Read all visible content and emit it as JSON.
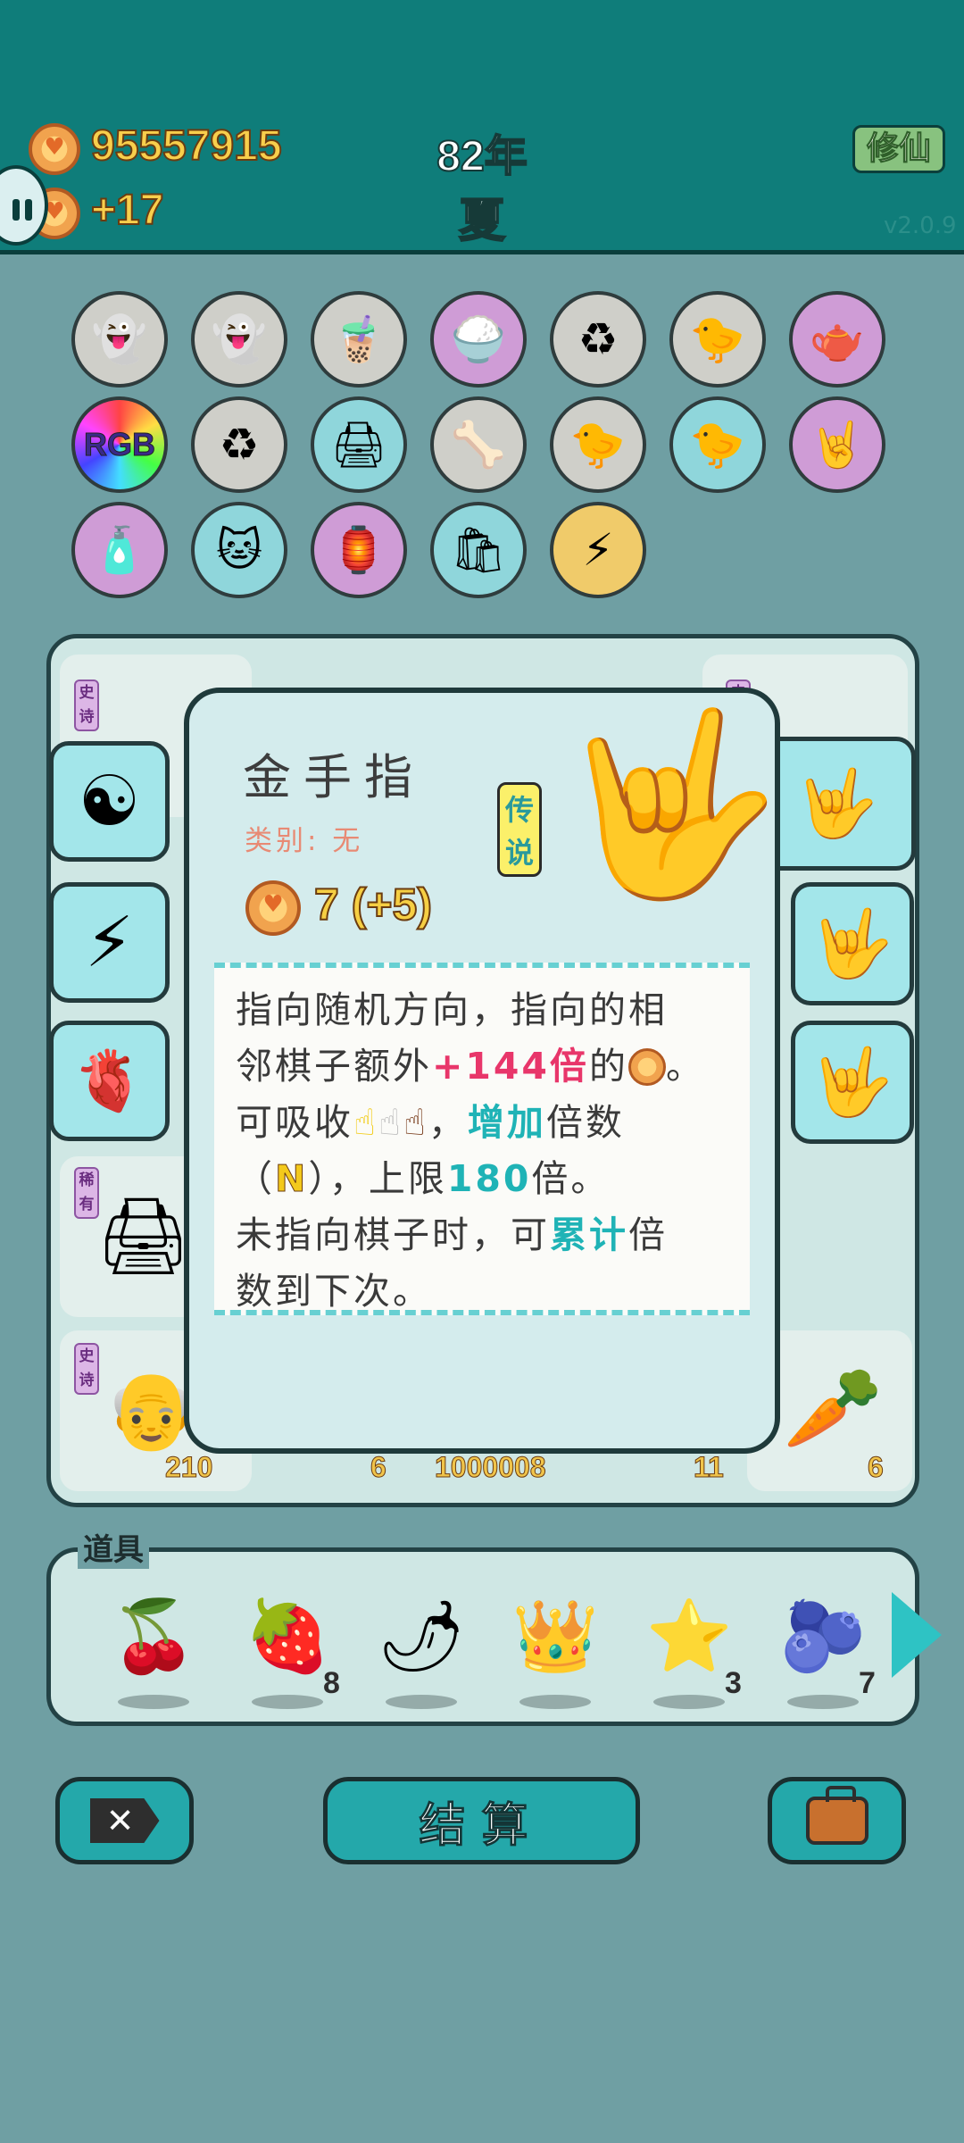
{
  "header": {
    "money": "95557915",
    "income": "+17",
    "year": "82年",
    "season": "夏",
    "mode_button": "修仙",
    "version": "v2.0.9"
  },
  "items": [
    {
      "name": "ghost-icon",
      "glyph": "👻",
      "style": "gray"
    },
    {
      "name": "ghost-icon",
      "glyph": "👻",
      "style": "gray"
    },
    {
      "name": "bubble-tea-icon",
      "glyph": "🧋",
      "style": "gray"
    },
    {
      "name": "rice-bowl-icon",
      "glyph": "🍚",
      "style": "purple"
    },
    {
      "name": "recycle-icon",
      "glyph": "♻",
      "style": "gray"
    },
    {
      "name": "chick-egg-icon",
      "glyph": "🐤",
      "style": "gray"
    },
    {
      "name": "gravy-boat-icon",
      "glyph": "🫖",
      "style": "purple"
    },
    {
      "name": "rgb-icon",
      "glyph": "RGB",
      "style": "rgb"
    },
    {
      "name": "recycle-icon",
      "glyph": "♻",
      "style": "gray"
    },
    {
      "name": "printer-icon",
      "glyph": "🖨",
      "style": "teal"
    },
    {
      "name": "pet-food-icon",
      "glyph": "🦴",
      "style": "gray"
    },
    {
      "name": "chick-egg-icon",
      "glyph": "🐤",
      "style": "gray"
    },
    {
      "name": "chick-egg-icon",
      "glyph": "🐤",
      "style": "teal"
    },
    {
      "name": "rock-hand-icon",
      "glyph": "🤘",
      "style": "purple"
    },
    {
      "name": "spray-bottle-icon",
      "glyph": "🧴",
      "style": "purple"
    },
    {
      "name": "cat-icon",
      "glyph": "🐱",
      "style": "teal"
    },
    {
      "name": "ghost-lamp-icon",
      "glyph": "🏮",
      "style": "purple"
    },
    {
      "name": "sack-icon",
      "glyph": "🛍",
      "style": "teal"
    },
    {
      "name": "lightning-icon",
      "glyph": "⚡",
      "style": "gold"
    }
  ],
  "board": {
    "counts": [
      "210",
      "6",
      "1000008",
      "11",
      "6"
    ],
    "tags": [
      "史诗",
      "传",
      "传",
      "史",
      "史诗",
      "稀有",
      "史诗"
    ]
  },
  "popup": {
    "title": "金手指",
    "category": "类别: 无",
    "rarity": "传说",
    "value": "7 (+5)",
    "desc": {
      "l1": "指向随机方向，指向的相",
      "l2a": "邻棋子额外",
      "l2b": "+144倍",
      "l2c": "的",
      "l2d": "。",
      "l3a": "可吸收",
      "l3b": "，",
      "l3c": "增加",
      "l3d": "倍数",
      "l4a": "（",
      "l4b": "N",
      "l4c": "），上限",
      "l4d": "180",
      "l4e": "倍。",
      "l5a": "未指向棋子时，可",
      "l5b": "累计",
      "l5c": "倍",
      "l6": "数到下次。"
    }
  },
  "props": {
    "label": "道具",
    "items": [
      {
        "name": "lychee-icon",
        "glyph": "🍒",
        "count": ""
      },
      {
        "name": "strawberry-icon",
        "glyph": "🍓",
        "count": "8"
      },
      {
        "name": "chili-icon",
        "glyph": "🌶",
        "count": ""
      },
      {
        "name": "crown-icon",
        "glyph": "👑",
        "count": ""
      },
      {
        "name": "star-icon",
        "glyph": "⭐",
        "count": "3"
      },
      {
        "name": "blueberry-icon",
        "glyph": "🫐",
        "count": "7"
      }
    ]
  },
  "buttons": {
    "close": "✕",
    "settle": "结算"
  }
}
